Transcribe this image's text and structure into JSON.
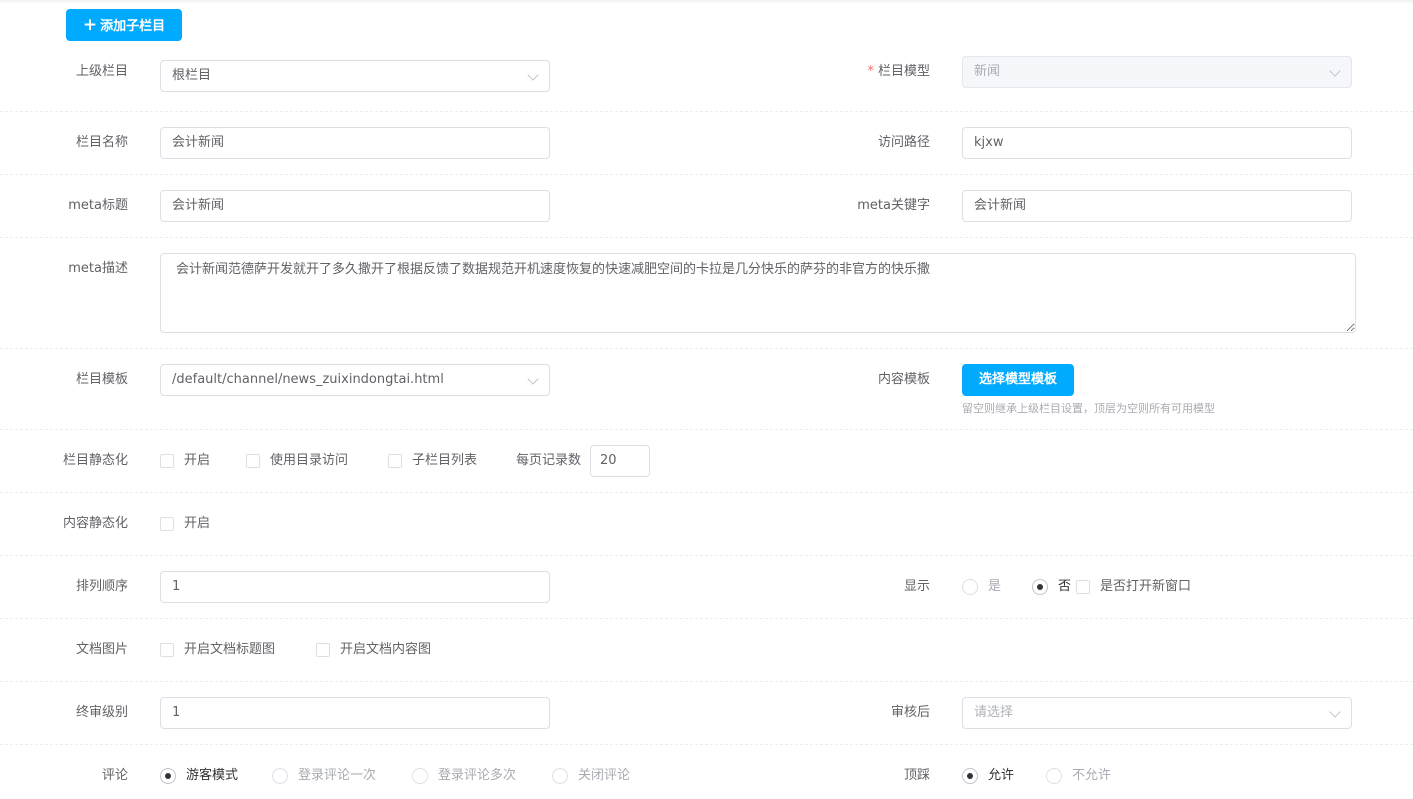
{
  "toolbar": {
    "add_child_label": "添加子栏目"
  },
  "form": {
    "parent": {
      "label": "上级栏目",
      "value": "根栏目"
    },
    "model": {
      "label": "栏目模型",
      "value": "新闻",
      "required_mark": "*"
    },
    "name": {
      "label": "栏目名称",
      "value": "会计新闻"
    },
    "path": {
      "label": "访问路径",
      "value": "kjxw"
    },
    "meta_title": {
      "label": "meta标题",
      "value": "会计新闻"
    },
    "meta_keywords": {
      "label": "meta关键字",
      "value": "会计新闻"
    },
    "meta_desc": {
      "label": "meta描述",
      "value": "会计新闻范德萨开发就开了多久撒开了根据反馈了数据规范开机速度恢复的快速减肥空间的卡拉是几分快乐的萨芬的非官方的快乐撒"
    },
    "channel_tpl": {
      "label": "栏目模板",
      "value": "/default/channel/news_zuixindongtai.html"
    },
    "content_tpl": {
      "label": "内容模板",
      "button": "选择模型模板",
      "hint": "留空则继承上级栏目设置，顶层为空则所有可用模型"
    },
    "channel_static": {
      "label": "栏目静态化",
      "options": [
        "开启",
        "使用目录访问",
        "子栏目列表"
      ],
      "per_page_label": "每页记录数",
      "per_page_value": "20"
    },
    "content_static": {
      "label": "内容静态化",
      "option": "开启"
    },
    "order": {
      "label": "排列顺序",
      "value": "1"
    },
    "display": {
      "label": "显示",
      "options": [
        "是",
        "否"
      ],
      "selected": "否",
      "new_window": "是否打开新窗口"
    },
    "doc_image": {
      "label": "文档图片",
      "options": [
        "开启文档标题图",
        "开启文档内容图"
      ]
    },
    "final_level": {
      "label": "终审级别",
      "value": "1"
    },
    "after_review": {
      "label": "审核后",
      "placeholder": "请选择"
    },
    "comment": {
      "label": "评论",
      "options": [
        "游客模式",
        "登录评论一次",
        "登录评论多次",
        "关闭评论"
      ],
      "selected": "游客模式"
    },
    "vote": {
      "label": "顶踩",
      "options": [
        "允许",
        "不允许"
      ],
      "selected": "允许"
    }
  }
}
